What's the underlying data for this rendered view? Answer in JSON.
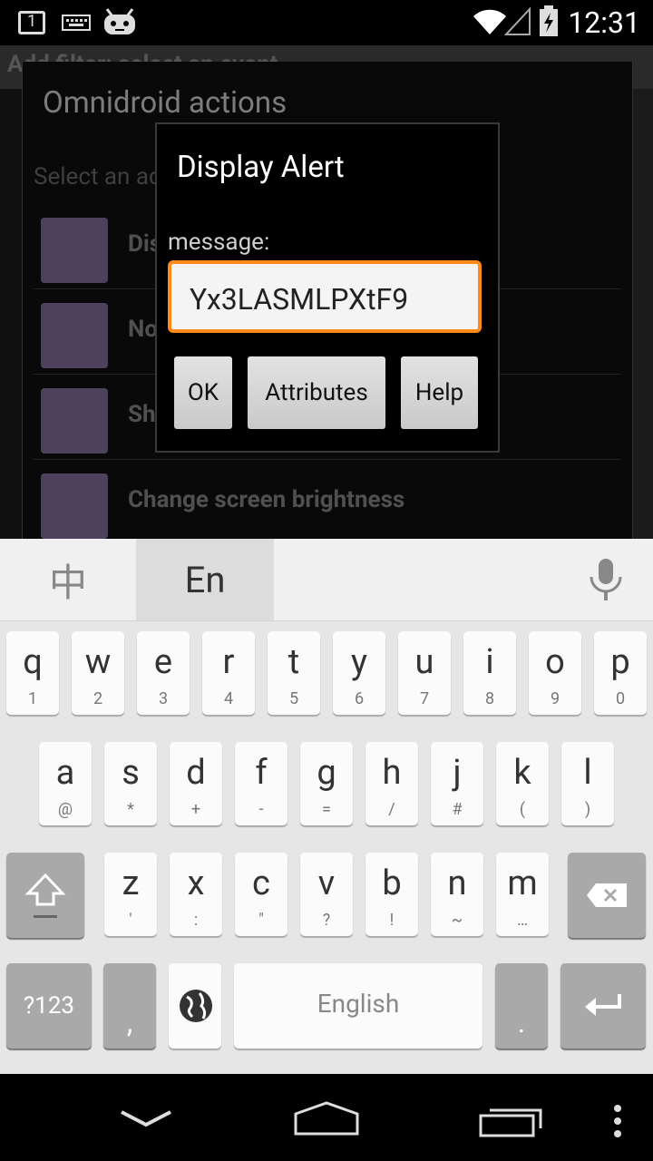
{
  "status_bar": {
    "time": "12:31",
    "notifications": [
      "calendar-1-icon",
      "keyboard-icon",
      "cyanogen-icon"
    ],
    "calendar_day": "1"
  },
  "background_activity": {
    "actionbar_title": "Add filter: select an event"
  },
  "actions_dialog": {
    "title": "Omnidroid actions",
    "subtitle": "Select an action [Omnidroid] to use:",
    "items": [
      {
        "label": "Display Alert"
      },
      {
        "label": "Notify message"
      },
      {
        "label": "Show toast"
      },
      {
        "label": "Change screen brightness"
      }
    ]
  },
  "alert_dialog": {
    "title": "Display Alert",
    "field_label": "message:",
    "field_value": "Yx3LASMLPXtF9",
    "buttons": {
      "ok": "OK",
      "attributes": "Attributes",
      "help": "Help"
    },
    "accent": "#ff8a1a"
  },
  "keyboard": {
    "lang_cn": "中",
    "lang_en": "En",
    "row1": [
      {
        "k": "q",
        "s": "1"
      },
      {
        "k": "w",
        "s": "2"
      },
      {
        "k": "e",
        "s": "3"
      },
      {
        "k": "r",
        "s": "4"
      },
      {
        "k": "t",
        "s": "5"
      },
      {
        "k": "y",
        "s": "6"
      },
      {
        "k": "u",
        "s": "7"
      },
      {
        "k": "i",
        "s": "8"
      },
      {
        "k": "o",
        "s": "9"
      },
      {
        "k": "p",
        "s": "0"
      }
    ],
    "row2": [
      {
        "k": "a",
        "s": "@"
      },
      {
        "k": "s",
        "s": "*"
      },
      {
        "k": "d",
        "s": "+"
      },
      {
        "k": "f",
        "s": "-"
      },
      {
        "k": "g",
        "s": "="
      },
      {
        "k": "h",
        "s": "/"
      },
      {
        "k": "j",
        "s": "#"
      },
      {
        "k": "k",
        "s": "("
      },
      {
        "k": "l",
        "s": ")"
      }
    ],
    "row3": [
      {
        "k": "z",
        "s": "'"
      },
      {
        "k": "x",
        "s": ":"
      },
      {
        "k": "c",
        "s": "\""
      },
      {
        "k": "v",
        "s": "?"
      },
      {
        "k": "b",
        "s": "!"
      },
      {
        "k": "n",
        "s": "~"
      },
      {
        "k": "m",
        "s": "…"
      }
    ],
    "symbols_key": "?123",
    "comma": ",",
    "space": "English",
    "period": "."
  }
}
